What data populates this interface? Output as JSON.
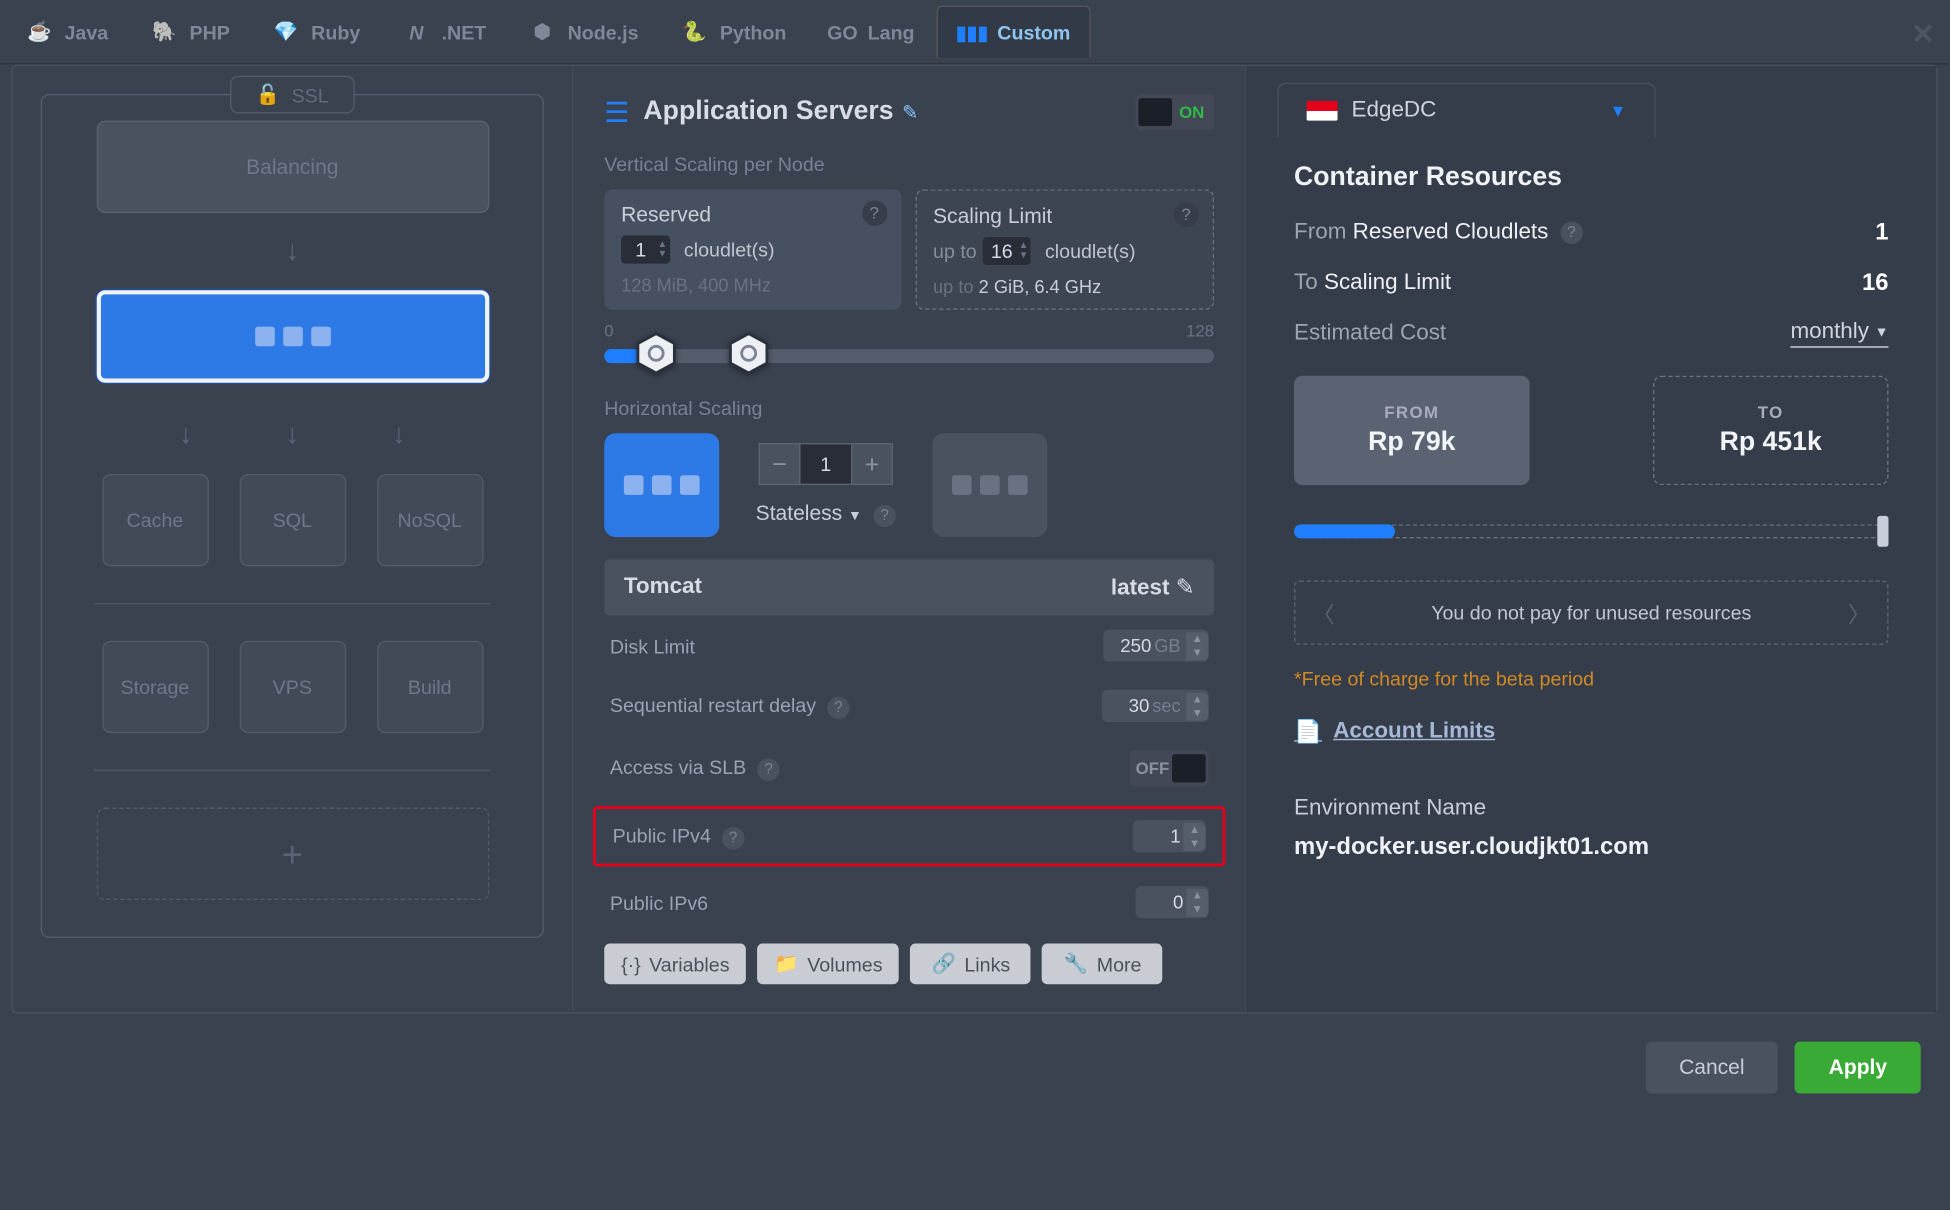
{
  "tabs": {
    "items": [
      {
        "label": "Java"
      },
      {
        "label": "PHP"
      },
      {
        "label": "Ruby"
      },
      {
        "label": ".NET"
      },
      {
        "label": "Node.js"
      },
      {
        "label": "Python"
      },
      {
        "label": "Lang"
      },
      {
        "label": "Custom"
      }
    ]
  },
  "topology": {
    "ssl": "SSL",
    "balancing": "Balancing",
    "cache": "Cache",
    "sql": "SQL",
    "nosql": "NoSQL",
    "storage": "Storage",
    "vps": "VPS",
    "build": "Build"
  },
  "appservers": {
    "title": "Application Servers",
    "on": "ON",
    "vertical_label": "Vertical Scaling per Node",
    "reserved": {
      "title": "Reserved",
      "value": "1",
      "unit": "cloudlet(s)",
      "hint": "128 MiB, 400 MHz"
    },
    "limit": {
      "title": "Scaling Limit",
      "prefix": "up to",
      "value": "16",
      "unit": "cloudlet(s)",
      "hint_prefix": "up to ",
      "hint": "2 GiB, 6.4 GHz"
    },
    "slider": {
      "min": "0",
      "max": "128"
    },
    "horizontal_label": "Horizontal Scaling",
    "hcount": "1",
    "mode": "Stateless",
    "server": {
      "name": "Tomcat",
      "version": "latest"
    },
    "disk": {
      "label": "Disk Limit",
      "value": "250",
      "unit": "GB"
    },
    "restart": {
      "label": "Sequential restart delay",
      "value": "30",
      "unit": "sec"
    },
    "slb": {
      "label": "Access via SLB",
      "state": "OFF"
    },
    "ipv4": {
      "label": "Public IPv4",
      "value": "1"
    },
    "ipv6": {
      "label": "Public IPv6",
      "value": "0"
    },
    "buttons": {
      "vars": "Variables",
      "vols": "Volumes",
      "links": "Links",
      "more": "More"
    }
  },
  "resources": {
    "datacenter": "EdgeDC",
    "title": "Container Resources",
    "from_label": "From",
    "from_target": "Reserved Cloudlets",
    "from_val": "1",
    "to_label": "To",
    "to_target": "Scaling Limit",
    "to_val": "16",
    "est": "Estimated Cost",
    "period": "monthly",
    "cost_from_label": "FROM",
    "cost_from": "Rp 79k",
    "cost_to_label": "TO",
    "cost_to": "Rp 451k",
    "info": "You do not pay for unused resources",
    "note": "*Free of charge for the beta period",
    "limits": "Account Limits",
    "env_label": "Environment Name",
    "env_name": "my-docker.user.cloudjkt01.com"
  },
  "footer": {
    "cancel": "Cancel",
    "apply": "Apply"
  }
}
